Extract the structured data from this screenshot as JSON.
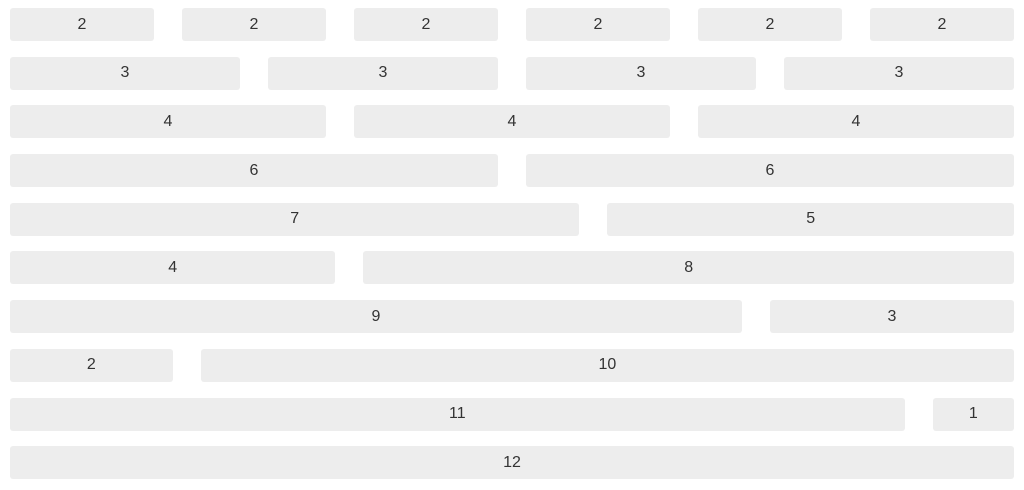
{
  "grid": {
    "rows": [
      [
        "2",
        "2",
        "2",
        "2",
        "2",
        "2"
      ],
      [
        "3",
        "3",
        "3",
        "3"
      ],
      [
        "4",
        "4",
        "4"
      ],
      [
        "6",
        "6"
      ],
      [
        "7",
        "5"
      ],
      [
        "4",
        "8"
      ],
      [
        "9",
        "3"
      ],
      [
        "2",
        "10"
      ],
      [
        "11",
        "1"
      ],
      [
        "12"
      ]
    ]
  }
}
